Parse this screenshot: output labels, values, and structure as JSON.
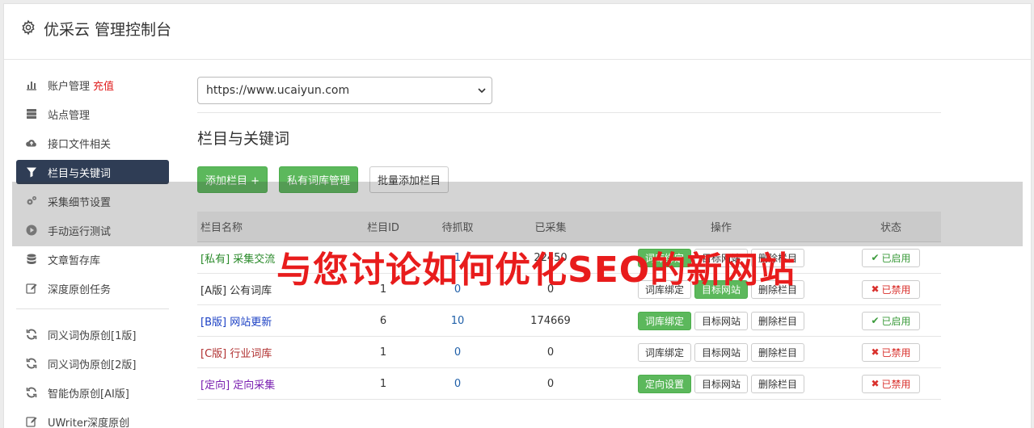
{
  "header": {
    "title": "优采云 管理控制台",
    "icon": "gear-icon"
  },
  "sidebar": {
    "items": [
      {
        "label": "账户管理",
        "extra": "充值",
        "icon": "bar-chart-icon",
        "active": false
      },
      {
        "label": "站点管理",
        "icon": "server-icon",
        "active": false
      },
      {
        "label": "接口文件相关",
        "icon": "cloud-upload-icon",
        "active": false
      },
      {
        "label": "栏目与关键词",
        "icon": "filter-icon",
        "active": true
      },
      {
        "label": "采集细节设置",
        "icon": "cogs-icon",
        "active": false
      },
      {
        "label": "手动运行测试",
        "icon": "play-icon",
        "active": false
      },
      {
        "label": "文章暂存库",
        "icon": "database-icon",
        "active": false
      },
      {
        "label": "深度原创任务",
        "icon": "edit-icon",
        "active": false
      }
    ],
    "items2": [
      {
        "label": "同义词伪原创[1版]",
        "icon": "refresh-icon"
      },
      {
        "label": "同义词伪原创[2版]",
        "icon": "refresh-icon"
      },
      {
        "label": "智能伪原创[AI版]",
        "icon": "refresh-icon"
      },
      {
        "label": "UWriter深度原创",
        "icon": "edit-icon"
      }
    ]
  },
  "main": {
    "site_select": "https://www.ucaiyun.com",
    "section_title": "栏目与关键词",
    "buttons": {
      "add_column": "添加栏目 +",
      "private_lexicon": "私有词库管理",
      "batch_add": "批量添加栏目"
    },
    "table": {
      "headers": [
        "栏目名称",
        "栏目ID",
        "待抓取",
        "已采集",
        "操作",
        "状态"
      ],
      "rows": [
        {
          "name": "[私有] 采集交流",
          "name_color": "#2a8a2a",
          "id": "",
          "pending": "1",
          "collected": "22450",
          "op1": "词库绑定",
          "op1_green": true,
          "op2": "目标网站",
          "op2_green": false,
          "op3": "删除栏目",
          "status": "已启用",
          "enabled": true
        },
        {
          "name": "[A版] 公有词库",
          "name_color": "#333333",
          "id": "1",
          "pending": "0",
          "collected": "0",
          "op1": "词库绑定",
          "op1_green": false,
          "op2": "目标网站",
          "op2_green": true,
          "op3": "删除栏目",
          "status": "已禁用",
          "enabled": false
        },
        {
          "name": "[B版] 网站更新",
          "name_color": "#1a3fc4",
          "id": "6",
          "pending": "10",
          "collected": "174669",
          "op1": "词库绑定",
          "op1_green": true,
          "op2": "目标网站",
          "op2_green": false,
          "op3": "删除栏目",
          "status": "已启用",
          "enabled": true
        },
        {
          "name": "[C版] 行业词库",
          "name_color": "#b03030",
          "id": "1",
          "pending": "0",
          "collected": "0",
          "op1": "词库绑定",
          "op1_green": false,
          "op2": "目标网站",
          "op2_green": false,
          "op3": "删除栏目",
          "status": "已禁用",
          "enabled": false
        },
        {
          "name": "[定向] 定向采集",
          "name_color": "#7a1fb0",
          "id": "1",
          "pending": "0",
          "collected": "0",
          "op1": "定向设置",
          "op1_green": true,
          "op2": "目标网站",
          "op2_green": false,
          "op3": "删除栏目",
          "status": "已禁用",
          "enabled": false
        }
      ]
    }
  },
  "watermark": "与您讨论如何优化SEO的新网站"
}
